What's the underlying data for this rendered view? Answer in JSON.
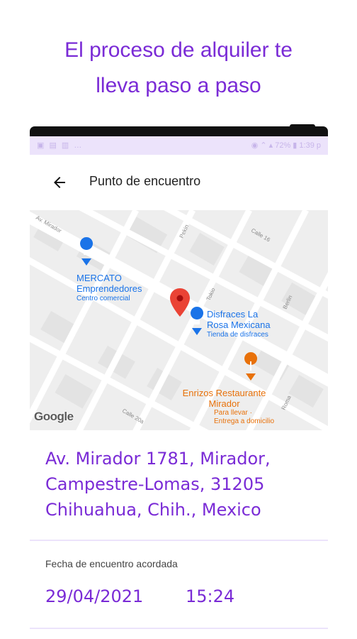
{
  "promo": {
    "line1": "El proceso de alquiler te",
    "line2": "lleva paso a paso"
  },
  "statusbar": {
    "left_icons": "▣ ▤ ▥ …",
    "right_text": "◉ ⌃ ▴ 72% ▮ 1:39 p"
  },
  "appbar": {
    "title": "Punto de encuentro",
    "back_icon": "arrow-left-icon"
  },
  "map": {
    "places": [
      {
        "name": "MERCATO\nEmprendedores",
        "category": "Centro comercial",
        "icon": "shopping-bag-icon",
        "color": "#1a73e8"
      },
      {
        "name": "Disfraces La\nRosa Mexicana",
        "category": "Tienda de disfraces",
        "icon": "shopping-bag-icon",
        "color": "#1a73e8"
      },
      {
        "name": "Enrizos Restaurante\nMirador",
        "category": "Para llevar ·\nEntrega a domicilio",
        "icon": "fork-knife-icon",
        "color": "#e8710a"
      }
    ],
    "streets": [
      "Av. Mirador",
      "Pekin",
      "Calle 16",
      "Tokio",
      "Berlin",
      "Calle 20a",
      "Roma"
    ],
    "marker": {
      "icon": "location-pin-icon",
      "color": "#ea4335"
    },
    "attribution": "Google"
  },
  "address": {
    "line1": "Av. Mirador 1781, Mirador,",
    "line2": "Campestre-Lomas, 31205",
    "line3": "Chihuahua, Chih., Mexico"
  },
  "meeting": {
    "label": "Fecha de encuentro acordada",
    "date": "29/04/2021",
    "time": "15:24"
  },
  "colors": {
    "accent": "#7a2bd6",
    "statusbar": "#ece3fb",
    "map_blue": "#1a73e8",
    "map_orange": "#e8710a",
    "marker_red": "#ea4335"
  }
}
